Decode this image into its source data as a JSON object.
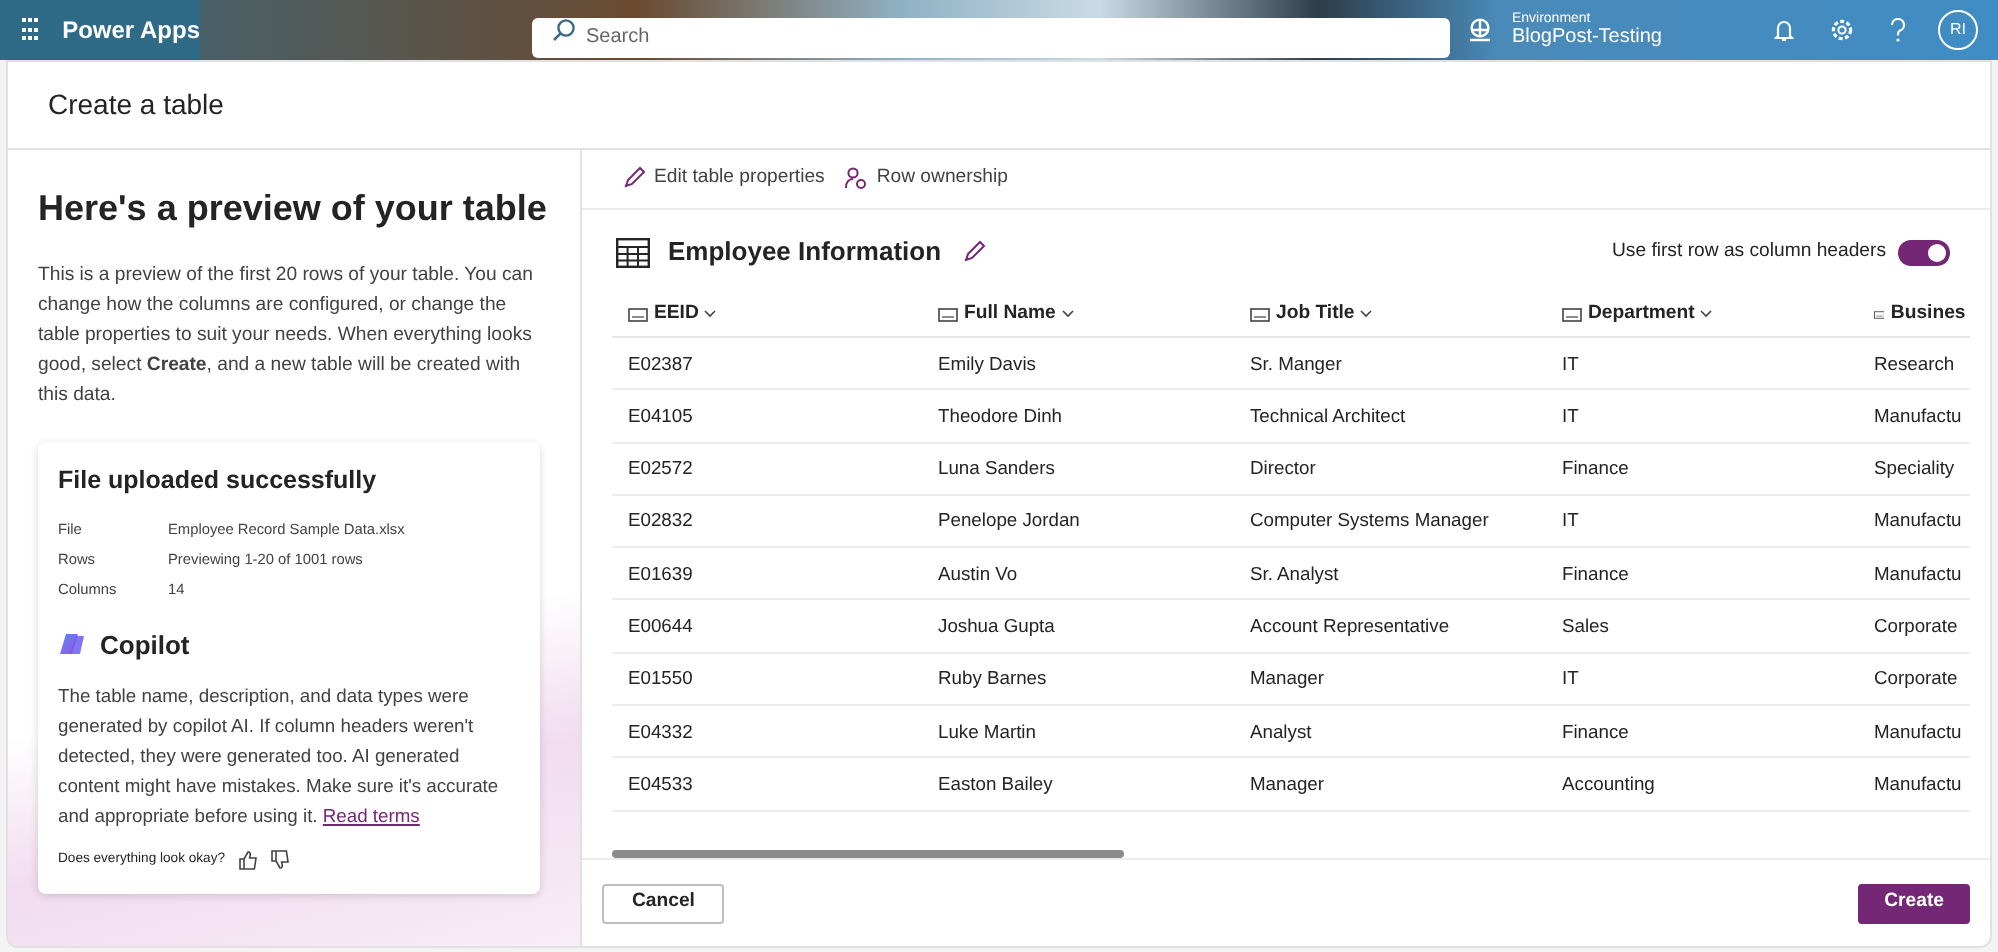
{
  "app_bar": {
    "app_name": "Power Apps",
    "search": {
      "placeholder": "Search"
    },
    "environment": {
      "label": "Environment",
      "name": "BlogPost-Testing"
    },
    "avatar": "RI"
  },
  "page_title": "Create a table",
  "left_panel": {
    "heading": "Here's a preview of your table",
    "description": "This is a preview of the first 20 rows of your table. You can change how the columns are configured, or change the table properties to suit your needs. When everything looks good, select **Create**, and a new table will be created with this data.",
    "upload_card": {
      "title": "File uploaded successfully",
      "details": [
        {
          "label": "File",
          "value": "Employee Record Sample Data.xlsx"
        },
        {
          "label": "Rows",
          "value": "Previewing 1-20 of 1001 rows"
        },
        {
          "label": "Columns",
          "value": "14"
        }
      ],
      "copilot": {
        "title": "Copilot",
        "text": "The table name, description, and data types were generated by copilot AI. If column headers weren't detected, they were generated too. AI generated content might have mistakes. Make sure it's accurate and appropriate before using it.",
        "link": "Read terms"
      },
      "feedback": "Does everything look okay?"
    }
  },
  "toolbar": [
    "Edit table properties",
    "Row ownership"
  ],
  "table": {
    "name": "Employee Information",
    "header_toggle": {
      "label": "Use first row as column headers",
      "on": true
    },
    "columns": [
      "EEID",
      "Full Name",
      "Job Title",
      "Department",
      "Busines"
    ],
    "rows": [
      [
        "E02387",
        "Emily Davis",
        "Sr. Manger",
        "IT",
        "Research"
      ],
      [
        "E04105",
        "Theodore Dinh",
        "Technical Architect",
        "IT",
        "Manufactu"
      ],
      [
        "E02572",
        "Luna Sanders",
        "Director",
        "Finance",
        "Speciality"
      ],
      [
        "E02832",
        "Penelope Jordan",
        "Computer Systems Manager",
        "IT",
        "Manufactu"
      ],
      [
        "E01639",
        "Austin Vo",
        "Sr. Analyst",
        "Finance",
        "Manufactu"
      ],
      [
        "E00644",
        "Joshua Gupta",
        "Account Representative",
        "Sales",
        "Corporate"
      ],
      [
        "E01550",
        "Ruby Barnes",
        "Manager",
        "IT",
        "Corporate"
      ],
      [
        "E04332",
        "Luke Martin",
        "Analyst",
        "Finance",
        "Manufactu"
      ],
      [
        "E04533",
        "Easton Bailey",
        "Manager",
        "Accounting",
        "Manufactu"
      ]
    ]
  },
  "footer": {
    "cancel": "Cancel",
    "create": "Create"
  }
}
